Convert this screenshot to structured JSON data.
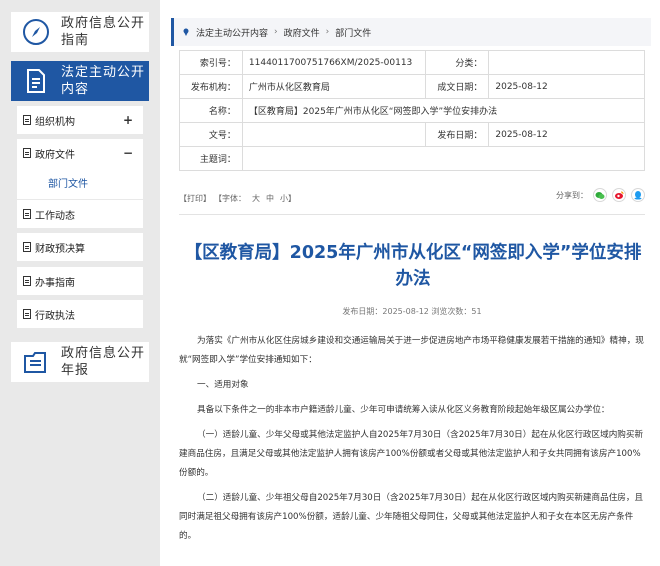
{
  "sidebar": {
    "top_card": "政府信息公开指南",
    "active_card": "法定主动公开内容",
    "items": [
      {
        "label": "组织机构",
        "sign": "+"
      },
      {
        "label": "政府文件",
        "sign": "−"
      },
      {
        "label": "工作动态",
        "sign": ""
      },
      {
        "label": "财政预决算",
        "sign": ""
      },
      {
        "label": "办事指南",
        "sign": ""
      },
      {
        "label": "行政执法",
        "sign": ""
      }
    ],
    "sub_item": "部门文件",
    "bottom_card": "政府信息公开年报"
  },
  "breadcrumb": [
    "法定主动公开内容",
    "政府文件",
    "部门文件"
  ],
  "meta": {
    "index_label": "索引号：",
    "index_value": "1144011700751766XM/2025-00113",
    "category_label": "分类：",
    "category_value": "",
    "issuer_label": "发布机构：",
    "issuer_value": "广州市从化区教育局",
    "created_label": "成文日期：",
    "created_value": "2025-08-12",
    "name_label": "名称：",
    "name_value": "【区教育局】2025年广州市从化区“网签即入学”学位安排办法",
    "docno_label": "文号：",
    "docno_value": "",
    "published_label": "发布日期：",
    "published_value": "2025-08-12",
    "subject_label": "主题词：",
    "subject_value": ""
  },
  "tools": {
    "print": "【打印】",
    "font": "【字体：",
    "large": "大",
    "medium": "中",
    "small": "小】",
    "share_label": "分享到：",
    "share_icons": [
      "wechat-icon",
      "weibo-icon",
      "qq-icon"
    ]
  },
  "article": {
    "title": "【区教育局】2025年广州市从化区“网签即入学”学位安排办法",
    "pubinfo": "发布日期：2025-08-12  浏览次数：51",
    "paragraphs": [
      "为落实《广州市从化区住房城乡建设和交通运输局关于进一步促进房地产市场平稳健康发展若干措施的通知》精神，现就“网签即入学”学位安排通知如下：",
      "一、适用对象",
      "具备以下条件之一的非本市户籍适龄儿童、少年可申请统筹入读从化区义务教育阶段起始年级区属公办学位：",
      "（一）适龄儿童、少年父母或其他法定监护人自2025年7月30日（含2025年7月30日）起在从化区行政区域内购买新建商品住房，且满足父母或其他法定监护人拥有该房产100%份额或者父母或其他法定监护人和子女共同拥有该房产100%份额的。",
      "（二）适龄儿童、少年祖父母自2025年7月30日（含2025年7月30日）起在从化区行政区域内购买新建商品住房，且同时满足祖父母拥有该房产100%份额，适龄儿童、少年随祖父母同住，父母或其他法定监护人和子女在本区无房产条件的。"
    ]
  },
  "colors": {
    "accent": "#1f57a3",
    "sidebar_bg": "#e9e9e9"
  }
}
